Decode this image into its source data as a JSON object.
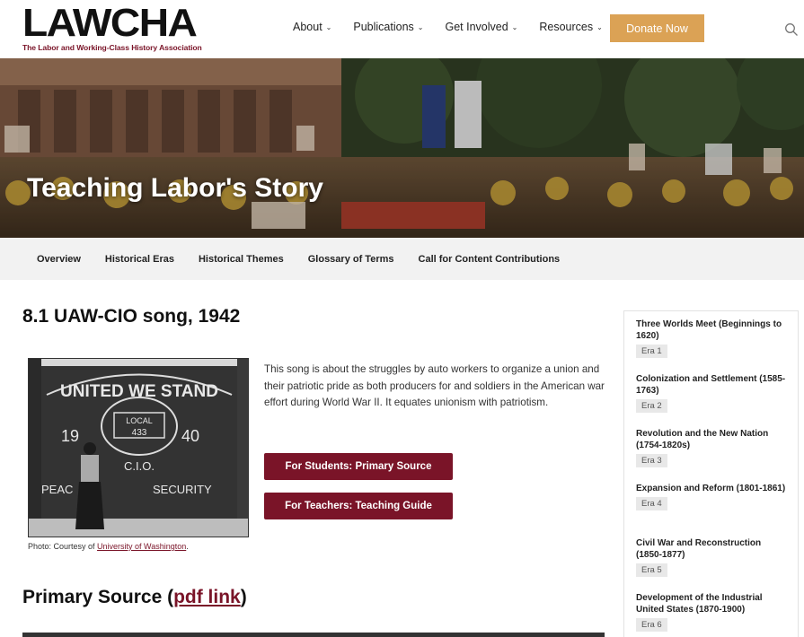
{
  "header": {
    "logo_text": "LAWCHA",
    "logo_subtitle": "The Labor and Working-Class History Association",
    "nav": [
      {
        "label": "About"
      },
      {
        "label": "Publications"
      },
      {
        "label": "Get Involved"
      },
      {
        "label": "Resources"
      }
    ],
    "donate_label": "Donate Now",
    "search_icon": "search-icon",
    "accent_color": "#dba255",
    "brand_color": "#7a1428"
  },
  "hero": {
    "title": "Teaching Labor's Story"
  },
  "subnav": [
    {
      "label": "Overview"
    },
    {
      "label": "Historical Eras"
    },
    {
      "label": "Historical Themes"
    },
    {
      "label": "Glossary of Terms"
    },
    {
      "label": "Call for Content Contributions"
    }
  ],
  "main": {
    "title": "8.1 UAW-CIO song, 1942",
    "caption_prefix": "Photo: Courtesy of ",
    "caption_link": "University of Washington",
    "caption_suffix": ".",
    "description": "This song is about the struggles by auto workers to organize a union and their patriotic pride as both producers for and soldiers in the American war effort during World War II. It equates unionism with patriotism.",
    "btn_students": "For Students: Primary Source",
    "btn_teachers": "For Teachers: Teaching Guide",
    "primary_heading_prefix": "Primary Source (",
    "primary_heading_link": "pdf link",
    "primary_heading_suffix": ")"
  },
  "sidebar": {
    "eras": [
      {
        "title": "Three Worlds Meet (Beginnings to 1620)",
        "badge": "Era 1"
      },
      {
        "title": "Colonization and Settlement (1585-1763)",
        "badge": "Era 2"
      },
      {
        "title": "Revolution and the New Nation (1754-1820s)",
        "badge": "Era 3"
      },
      {
        "title": "Expansion and Reform (1801-1861)",
        "badge": "Era 4"
      },
      {
        "title": "Civil War and Reconstruction (1850-1877)",
        "badge": "Era 5"
      },
      {
        "title": "Development of the Industrial United States (1870-1900)",
        "badge": "Era 6"
      }
    ]
  }
}
